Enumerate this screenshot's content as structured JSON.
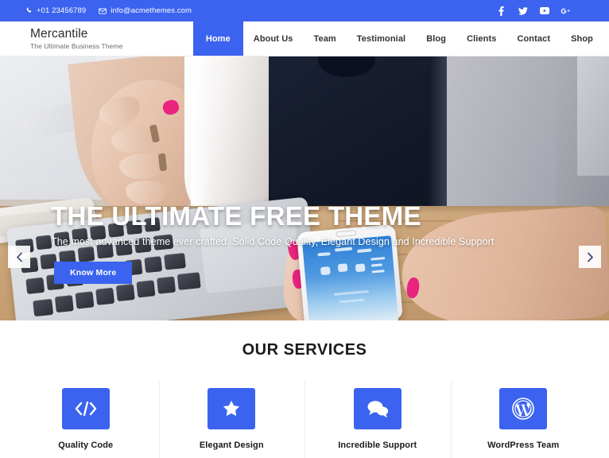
{
  "topbar": {
    "phone": "+01 23456789",
    "email": "info@acmethemes.com",
    "phone_icon": "phone-icon",
    "email_icon": "envelope-icon",
    "social": [
      {
        "name": "facebook-icon",
        "label": "f"
      },
      {
        "name": "twitter-icon",
        "label": "t"
      },
      {
        "name": "youtube-icon",
        "label": "y"
      },
      {
        "name": "googleplus-icon",
        "label": "G+"
      }
    ],
    "bg_color": "#3b63f0"
  },
  "brand": {
    "title": "Mercantile",
    "tagline": "The Ultimate Business Theme"
  },
  "nav": {
    "items": [
      {
        "label": "Home",
        "active": true
      },
      {
        "label": "About Us",
        "active": false
      },
      {
        "label": "Team",
        "active": false
      },
      {
        "label": "Testimonial",
        "active": false
      },
      {
        "label": "Blog",
        "active": false
      },
      {
        "label": "Clients",
        "active": false
      },
      {
        "label": "Contact",
        "active": false
      },
      {
        "label": "Shop",
        "active": false
      }
    ],
    "active_color": "#3b63f0"
  },
  "hero": {
    "title": "THE ULTIMATE FREE THEME",
    "subtitle": "The most advanced theme ever crafted. Solid Code Quality, Elegant Design and Incredible Support",
    "button_label": "Know More",
    "prev_icon": "chevron-left-icon",
    "next_icon": "chevron-right-icon",
    "button_color": "#3b63f0"
  },
  "services": {
    "heading": "OUR SERVICES",
    "items": [
      {
        "label": "Quality Code",
        "icon": "code-icon"
      },
      {
        "label": "Elegant Design",
        "icon": "star-icon"
      },
      {
        "label": "Incredible Support",
        "icon": "chat-bubbles-icon"
      },
      {
        "label": "WordPress Team",
        "icon": "wordpress-icon"
      }
    ],
    "icon_bg": "#3b63f0"
  }
}
